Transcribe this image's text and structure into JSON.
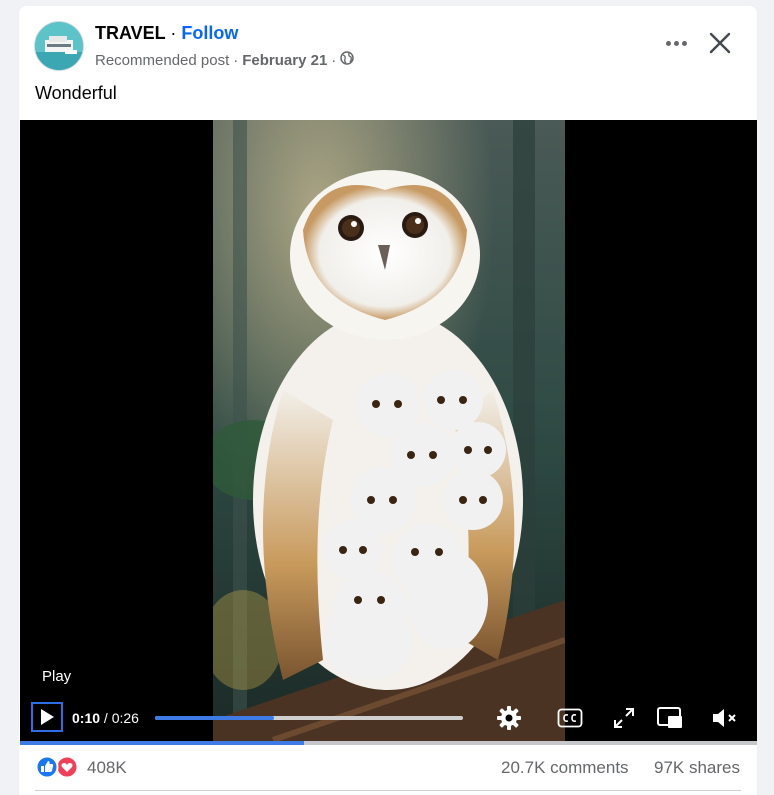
{
  "post": {
    "author": "TRAVEL",
    "separator": "·",
    "follow_label": "Follow",
    "recommended": "Recommended post",
    "meta_sep": "·",
    "date": "February 21",
    "meta_sep2": "·",
    "audience_icon": "globe-icon",
    "caption": "Wonderful"
  },
  "header": {
    "more_icon": "more-horizontal-icon",
    "close_icon": "close-icon"
  },
  "video": {
    "play_label": "Play",
    "current_time": "0:10",
    "time_separator": " / ",
    "duration": "0:26",
    "progress_fraction": 0.385,
    "controls": [
      "play-icon",
      "settings-icon",
      "closed-captions-icon",
      "fullscreen-icon",
      "picture-in-picture-icon",
      "mute-icon"
    ]
  },
  "engagement": {
    "reaction_icons": [
      "like-icon",
      "love-icon"
    ],
    "reaction_count": "408K",
    "comments": "20.7K comments",
    "shares": "97K shares"
  },
  "colors": {
    "accent": "#0866ff",
    "like": "#1877f2",
    "love": "#f33e58",
    "progress": "#3f7be6",
    "muted_text": "#65676b"
  }
}
